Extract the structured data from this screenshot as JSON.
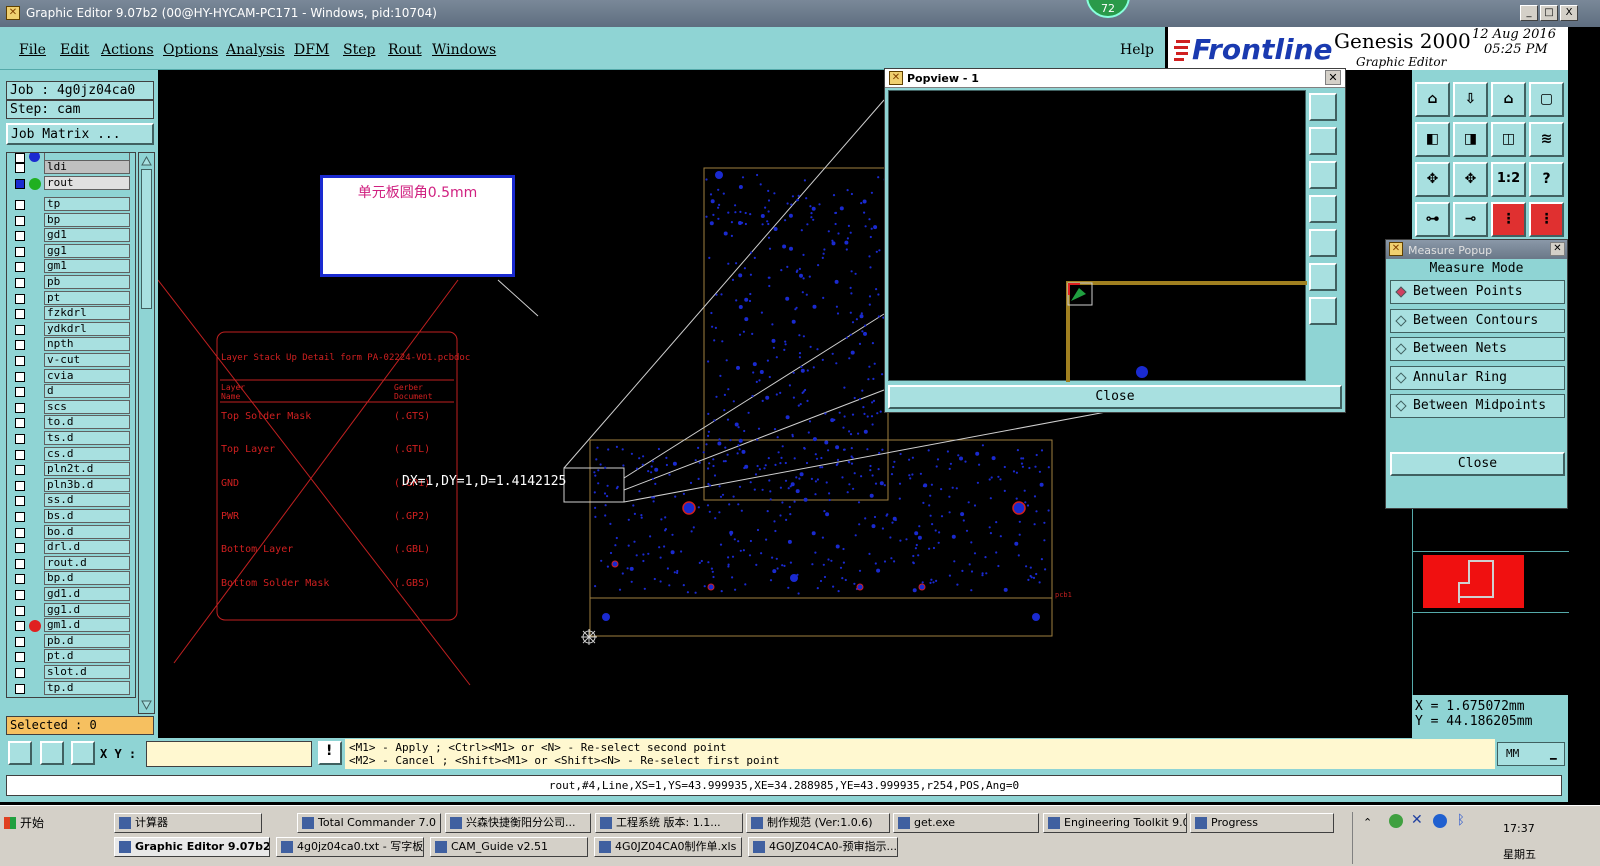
{
  "window": {
    "title": "Graphic Editor 9.07b2 (00@HY-HYCAM-PC171 - Windows, pid:10704)",
    "badge": "72",
    "controls": [
      "_",
      "□",
      "X"
    ]
  },
  "menu": [
    "File",
    "Edit",
    "Actions",
    "Options",
    "Analysis",
    "DFM",
    "Step",
    "Rout",
    "Windows"
  ],
  "help": "Help",
  "brand": {
    "logo": "Frontline",
    "product": "Genesis 2000",
    "subtitle": "Graphic Editor",
    "date": "12 Aug 2016",
    "time": "05:25 PM"
  },
  "left": {
    "job": "Job : 4g0jz04ca0",
    "step": "Step: cam",
    "job_matrix": "Job Matrix ...",
    "selected": "Selected : 0",
    "top_layers": [
      "ldi",
      "rout"
    ],
    "layers": [
      "tp",
      "bp",
      "gd1",
      "gg1",
      "gm1",
      "pb",
      "pt",
      "fzkdrl",
      "ydkdrl",
      "npth",
      "v-cut",
      "cvia",
      "d",
      "scs",
      "to.d",
      "ts.d",
      "cs.d",
      "pln2t.d",
      "pln3b.d",
      "ss.d",
      "bs.d",
      "bo.d",
      "drl.d",
      "rout.d",
      "bp.d",
      "gd1.d",
      "gg1.d",
      "gm1.d",
      "pb.d",
      "pt.d",
      "slot.d",
      "tp.d"
    ]
  },
  "canvas": {
    "note": "单元板圆角0.5mm",
    "measure_label": "DX=1,DY=1,D=1.4142125",
    "stack_title": "Layer Stack Up Detail form PA-02224-VO1.pcbdoc",
    "stack_header_left": "Layer Name",
    "stack_header_right": "Gerber Document",
    "stack_rows": [
      {
        "name": "Top Solder Mask",
        "ext": "(.GTS)"
      },
      {
        "name": "Top Layer",
        "ext": "(.GTL)"
      },
      {
        "name": "GND",
        "ext": "(.GP1)"
      },
      {
        "name": "PWR",
        "ext": "(.GP2)"
      },
      {
        "name": "Bottom Layer",
        "ext": "(.GBL)"
      },
      {
        "name": "Bottom Solder Mask",
        "ext": "(.GBS)"
      }
    ],
    "pcb_tag": "pcb1"
  },
  "popview": {
    "title": "Popview - 1",
    "close": "Close"
  },
  "measure": {
    "title": "Measure Popup",
    "mode_label": "Measure Mode",
    "options": [
      "Between Points",
      "Between Contours",
      "Between Nets",
      "Annular Ring",
      "Between Midpoints"
    ],
    "selected_index": 0,
    "close": "Close"
  },
  "right_tools": [
    "1:2",
    "?"
  ],
  "coords": {
    "x": "X  =  1.675072mm",
    "y": "Y  =  44.186205mm"
  },
  "cmd": {
    "xy_label": "X Y :",
    "xy_value": "",
    "msg_line1": "<M1> - Apply  ; <Ctrl><M1> or <N> - Re-select second point",
    "msg_line2": "<M2> - Cancel ; <Shift><M1> or <Shift><N> - Re-select first point",
    "units": "MM"
  },
  "status": "rout,#4,Line,XS=1,YS=43.999935,XE=34.288985,YE=43.999935,r254,POS,Ang=0",
  "taskbar": {
    "start": "开始",
    "row1": [
      "计算器",
      "Total Commander 7.0 ...",
      "兴森快捷衡阳分公司...",
      "工程系统  版本: 1.1...",
      "制作规范 (Ver:1.0.6)",
      "get.exe",
      "Engineering Toolkit 9.0...",
      "Progress"
    ],
    "row2": [
      "Graphic Editor 9.07b2 ...",
      "4g0jz04ca0.txt - 写字板",
      "CAM_Guide v2.51",
      "4G0JZ04CA0制作单.xls ...",
      "4G0JZ04CA0-预审指示..."
    ],
    "clock": "17:37",
    "day": "星期五"
  }
}
